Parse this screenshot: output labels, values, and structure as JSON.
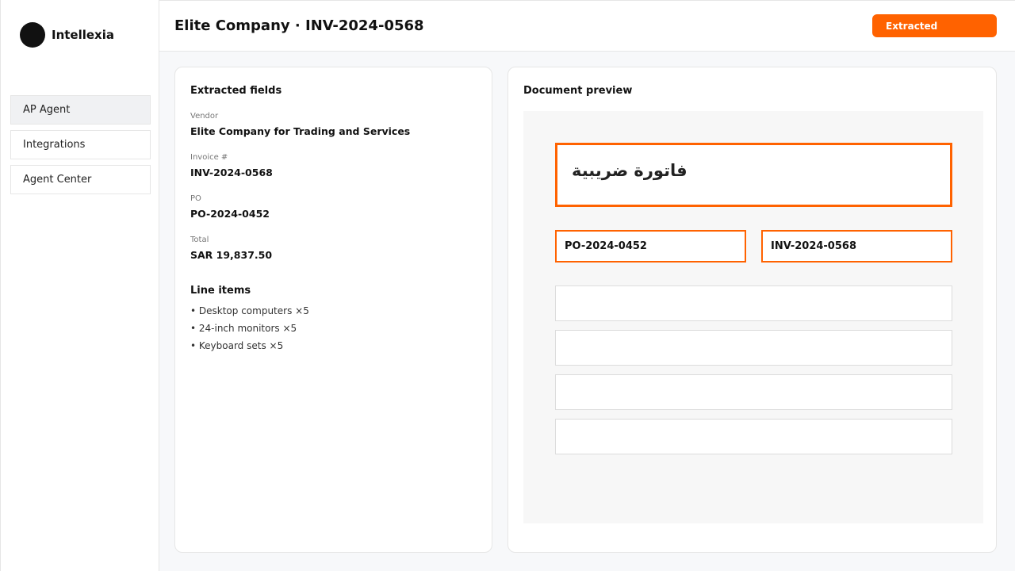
{
  "app": {
    "name": "Intellexia"
  },
  "sidebar": {
    "items": [
      {
        "label": "AP Agent",
        "active": true
      },
      {
        "label": "Integrations",
        "active": false
      },
      {
        "label": "Agent Center",
        "active": false
      }
    ]
  },
  "header": {
    "title": "Elite Company · INV-2024-0568",
    "status": "Extracted",
    "status_color": "#ff6200"
  },
  "fields": {
    "title": "Extracted fields",
    "vendor": {
      "label": "Vendor",
      "value": "Elite Company for Trading and Services"
    },
    "invoice": {
      "label": "Invoice #",
      "value": "INV-2024-0568"
    },
    "po": {
      "label": "PO",
      "value": "PO-2024-0452"
    },
    "total": {
      "label": "Total",
      "value": "SAR 19,837.50"
    }
  },
  "line_items": {
    "title": "Line items",
    "items": [
      "• Desktop computers ×5",
      "• 24-inch monitors ×5",
      "• Keyboard sets ×5"
    ]
  },
  "preview": {
    "title": "Document preview",
    "doc_title": "فاتورة ضريبية",
    "po_ref": "PO-2024-0452",
    "invoice_ref": "INV-2024-0568",
    "highlight_color": "#ff6200"
  }
}
